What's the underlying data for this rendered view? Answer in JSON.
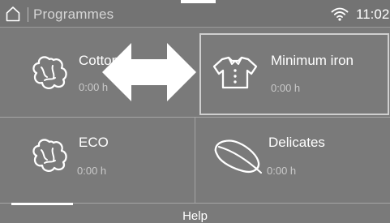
{
  "status_bar": {
    "title": "Programmes",
    "time": "11:02",
    "home_icon": "home-icon",
    "wifi_icon": "wifi-icon"
  },
  "programmes": [
    {
      "label": "Cottons",
      "duration": "0:00 h",
      "icon": "cotton-icon"
    },
    {
      "label": "Minimum iron",
      "duration": "0:00 h",
      "icon": "shirt-icon",
      "selected": true
    },
    {
      "label": "ECO",
      "duration": "0:00 h",
      "icon": "cotton-icon"
    },
    {
      "label": "Delicates",
      "duration": "0:00 h",
      "icon": "feather-icon"
    }
  ],
  "overlay": {
    "icon": "swipe-arrow-icon"
  },
  "footer": {
    "help_label": "Help"
  },
  "colors": {
    "background": "#7a7a7a",
    "text": "#ffffff",
    "muted": "#c9c9c9",
    "selection_border": "#cfcfcf"
  }
}
